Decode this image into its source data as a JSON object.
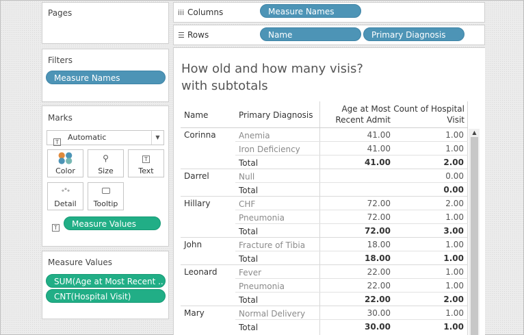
{
  "pages": {
    "title": "Pages"
  },
  "shelves": {
    "columns_label": "Columns",
    "columns_pills": [
      "Measure Names"
    ],
    "rows_label": "Rows",
    "rows_pills": [
      "Name",
      "Primary Diagnosis"
    ]
  },
  "filters": {
    "title": "Filters",
    "pills": [
      "Measure Names"
    ]
  },
  "marks": {
    "title": "Marks",
    "type": "Automatic",
    "buttons": [
      "Color",
      "Size",
      "Text",
      "Detail",
      "Tooltip"
    ],
    "measure_values_pill": "Measure Values"
  },
  "measure_values": {
    "title": "Measure Values",
    "pills": [
      "SUM(Age at Most Recent ..",
      "CNT(Hospital Visit)"
    ]
  },
  "view": {
    "title_line1": "How old and how many visis?",
    "title_line2": "with subtotals",
    "headers": {
      "name": "Name",
      "diagnosis": "Primary Diagnosis",
      "age_line1": "Age at Most",
      "age_line2": "Recent Admit",
      "count_line1": "Count of Hospital",
      "count_line2": "Visit"
    },
    "rows": [
      {
        "name": "Corinna",
        "diag": "Anemia",
        "age": "41.00",
        "count": "1.00",
        "total": false
      },
      {
        "name": "",
        "diag": "Iron Deficiency",
        "age": "41.00",
        "count": "1.00",
        "total": false
      },
      {
        "name": "",
        "diag": "Total",
        "age": "41.00",
        "count": "2.00",
        "total": true
      },
      {
        "name": "Darrel",
        "diag": "Null",
        "age": "",
        "count": "0.00",
        "total": false
      },
      {
        "name": "",
        "diag": "Total",
        "age": "",
        "count": "0.00",
        "total": true
      },
      {
        "name": "Hillary",
        "diag": "CHF",
        "age": "72.00",
        "count": "2.00",
        "total": false
      },
      {
        "name": "",
        "diag": "Pneumonia",
        "age": "72.00",
        "count": "1.00",
        "total": false
      },
      {
        "name": "",
        "diag": "Total",
        "age": "72.00",
        "count": "3.00",
        "total": true
      },
      {
        "name": "John",
        "diag": "Fracture of Tibia",
        "age": "18.00",
        "count": "1.00",
        "total": false
      },
      {
        "name": "",
        "diag": "Total",
        "age": "18.00",
        "count": "1.00",
        "total": true
      },
      {
        "name": "Leonard",
        "diag": "Fever",
        "age": "22.00",
        "count": "1.00",
        "total": false
      },
      {
        "name": "",
        "diag": "Pneumonia",
        "age": "22.00",
        "count": "1.00",
        "total": false
      },
      {
        "name": "",
        "diag": "Total",
        "age": "22.00",
        "count": "2.00",
        "total": true
      },
      {
        "name": "Mary",
        "diag": "Normal Delivery",
        "age": "30.00",
        "count": "1.00",
        "total": false
      },
      {
        "name": "",
        "diag": "Total",
        "age": "30.00",
        "count": "1.00",
        "total": true
      }
    ]
  }
}
